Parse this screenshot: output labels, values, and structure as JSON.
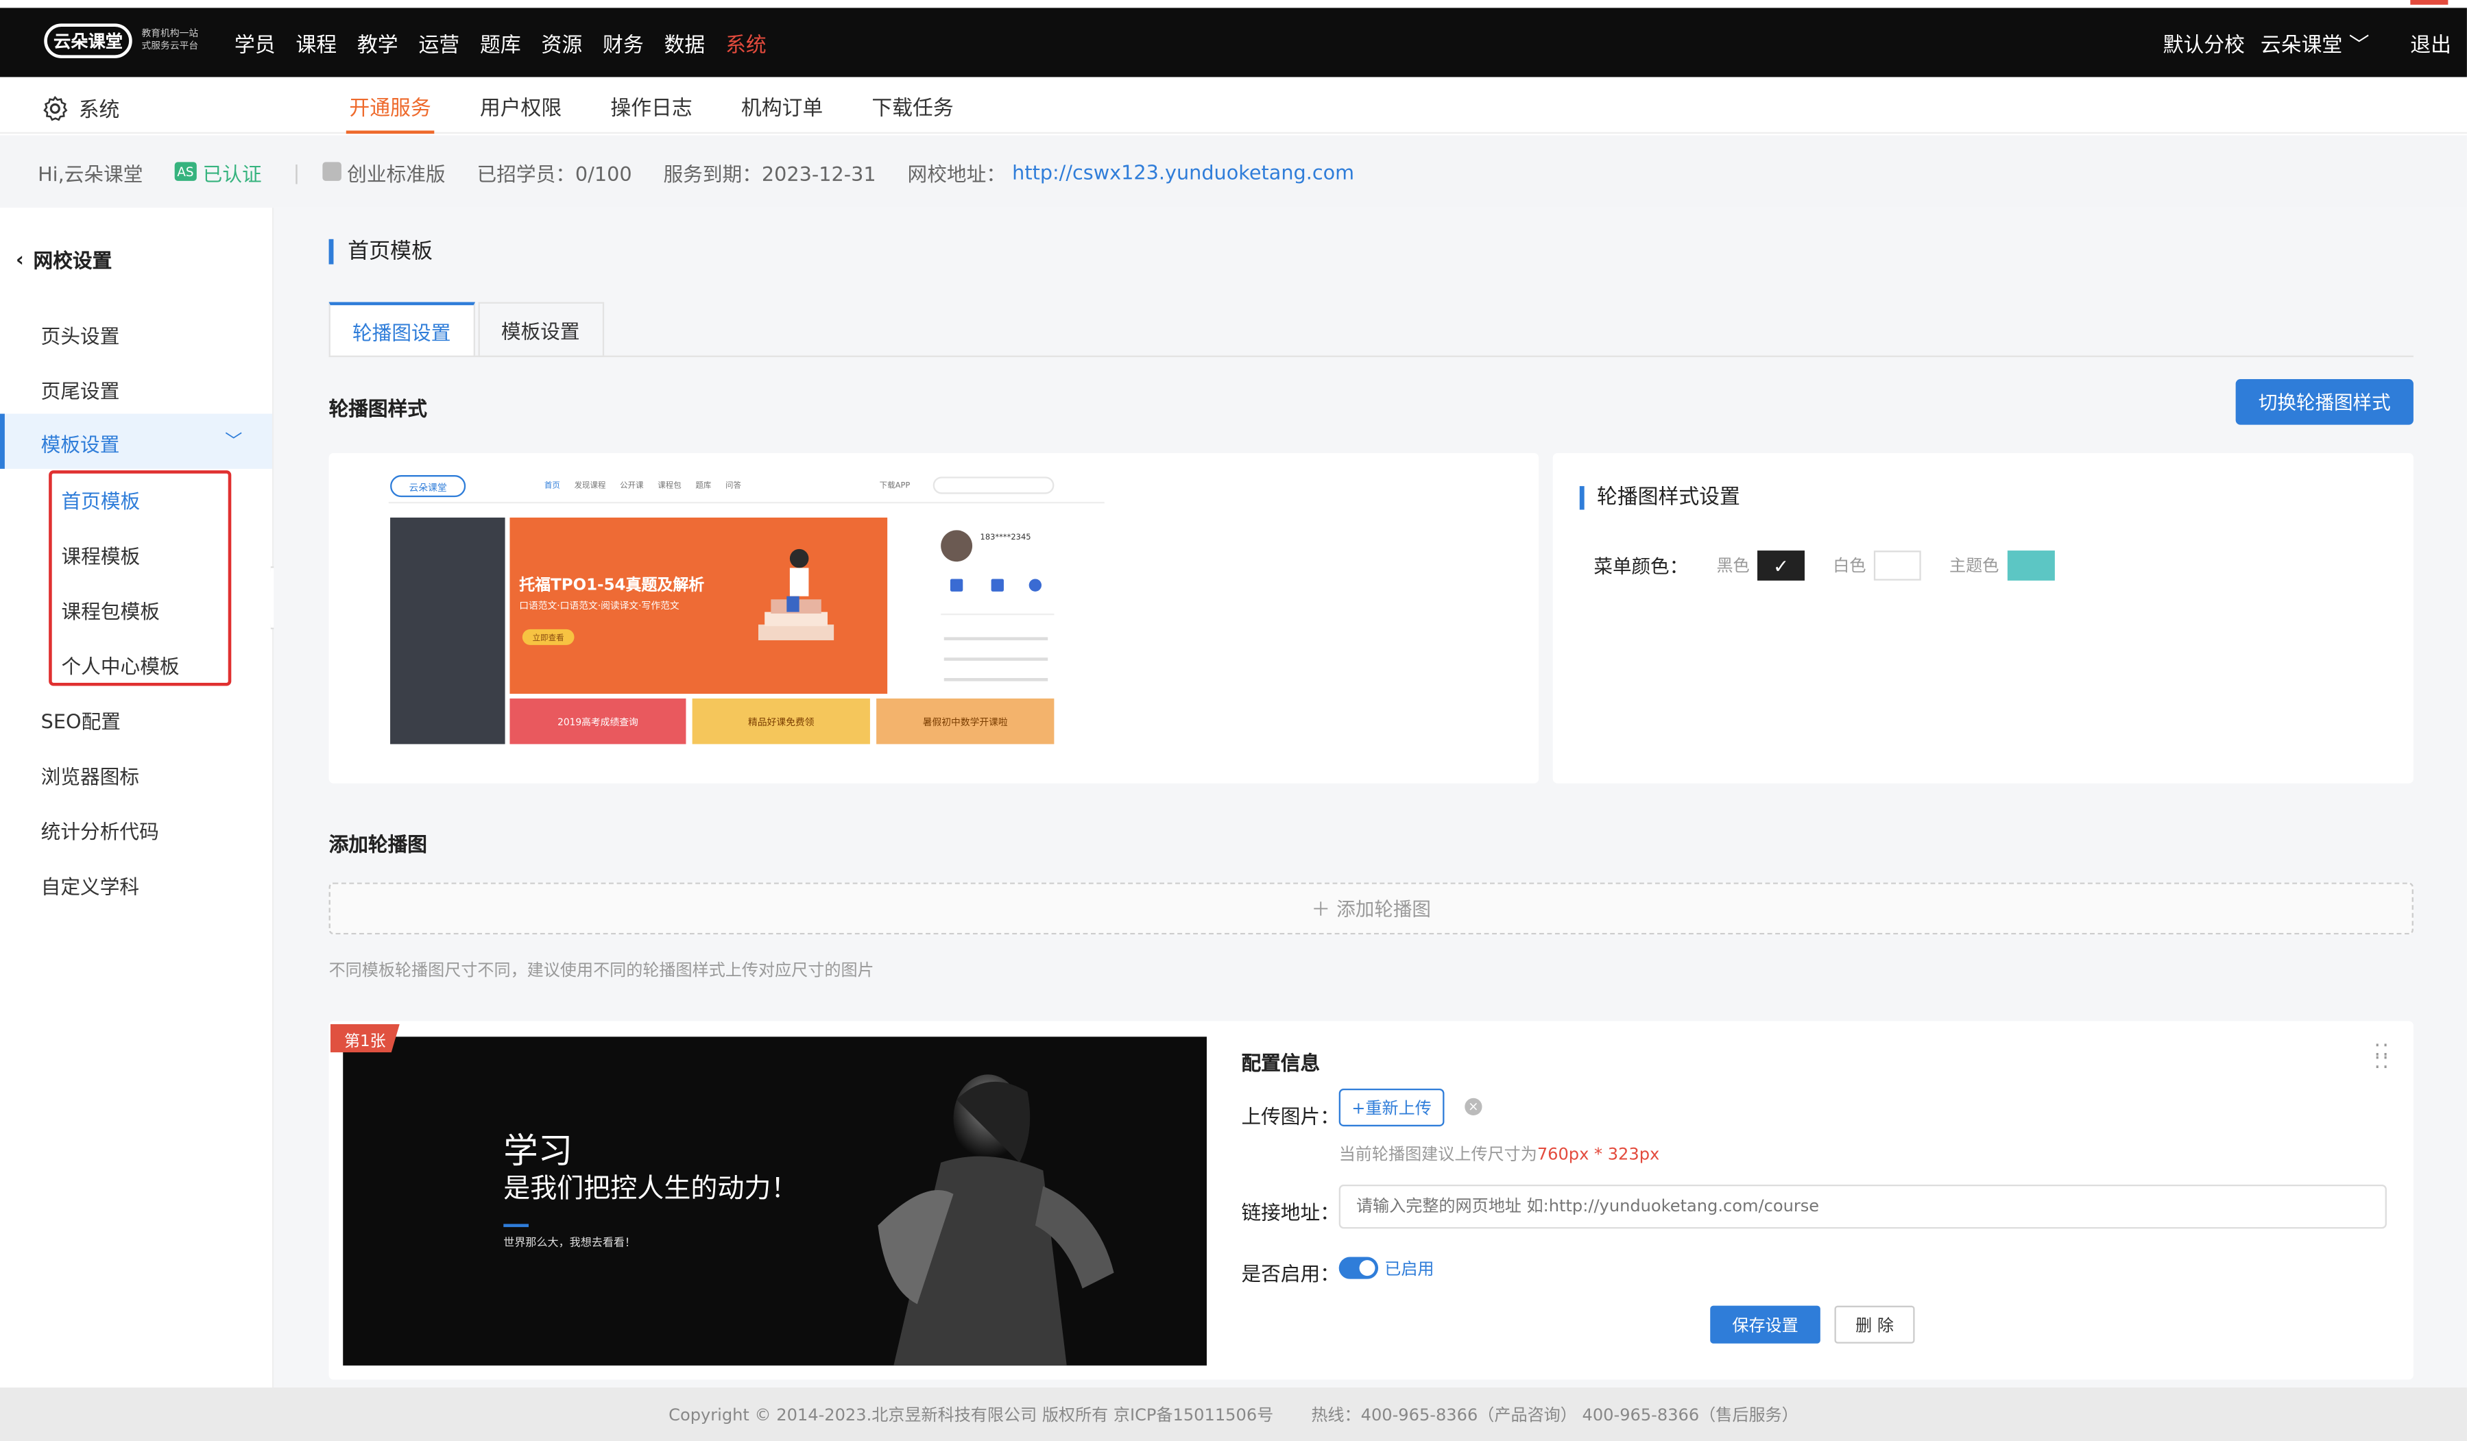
{
  "topbar": {
    "logo_text": "云朵课堂",
    "logo_sub": "教育机构一站式服务云平台",
    "nav": [
      "学员",
      "课程",
      "教学",
      "运营",
      "题库",
      "资源",
      "财务",
      "数据",
      "系统"
    ],
    "active_nav": "系统",
    "branch": "默认分校",
    "user": "云朵课堂",
    "logout": "退出"
  },
  "subnav": {
    "title": "系统",
    "tabs": [
      "开通服务",
      "用户权限",
      "操作日志",
      "机构订单",
      "下载任务"
    ],
    "active_tab": "开通服务"
  },
  "infobar": {
    "greeting": "Hi,云朵课堂",
    "certified": "已认证",
    "edition": "创业标准版",
    "students": "已招学员：0/100",
    "expiry": "服务到期：2023-12-31",
    "site_label": "网校地址：",
    "site_url": "http://cswx123.yunduoketang.com"
  },
  "sidebar": {
    "back": "网校设置",
    "items": [
      "页头设置",
      "页尾设置",
      "模板设置",
      "SEO配置",
      "浏览器图标",
      "统计分析代码",
      "自定义学科"
    ],
    "sub_items": [
      "首页模板",
      "课程模板",
      "课程包模板",
      "个人中心模板"
    ]
  },
  "main": {
    "page_title": "首页模板",
    "tabs": [
      "轮播图设置",
      "模板设置"
    ],
    "carousel_style_title": "轮播图样式",
    "switch_button": "切换轮播图样式",
    "preview": {
      "banner_title": "托福TPO1-54真题及解析",
      "banner_sub": "口语范文·口语范文·阅读译文·写作范文",
      "banner_btn": "立即查看",
      "nav_items": [
        "首页",
        "发现课程",
        "公开课",
        "课程包",
        "题库",
        "问答"
      ],
      "download": "下载APP",
      "user": "183****2345",
      "thumbs": [
        "2019高考成绩查询",
        "精品好课免费领",
        "暑假初中数学开课啦"
      ]
    },
    "style_settings_title": "轮播图样式设置",
    "menu_color_label": "菜单颜色：",
    "color_options": [
      {
        "label": "黑色",
        "color": "#222222",
        "checked": true
      },
      {
        "label": "白色",
        "color": "#ffffff",
        "checked": false
      },
      {
        "label": "主题色",
        "color": "#5cc6c4",
        "checked": false
      }
    ],
    "add_title": "添加轮播图",
    "add_button": "添加轮播图",
    "hint": "不同模板轮播图尺寸不同，建议使用不同的轮播图样式上传对应尺寸的图片",
    "item": {
      "ribbon": "第1张",
      "image_line1": "学习",
      "image_line2": "是我们把控人生的动力！",
      "image_line3": "世界那么大，我想去看看！",
      "config_title": "配置信息",
      "upload_label": "上传图片：",
      "reupload": "+重新上传",
      "size_hint_prefix": "当前轮播图建议上传尺寸为",
      "size_hint_value": "760px * 323px",
      "link_label": "链接地址：",
      "link_placeholder": "请输入完整的网页地址 如:http://yunduoketang.com/course",
      "enable_label": "是否启用：",
      "enable_status": "已启用",
      "save": "保存设置",
      "delete": "删 除"
    }
  },
  "footer": {
    "copyright": "Copyright © 2014-2023.北京昱新科技有限公司 版权所有 京ICP备15011506号",
    "hotline": "热线：400-965-8366（产品咨询） 400-965-8366（售后服务）"
  }
}
